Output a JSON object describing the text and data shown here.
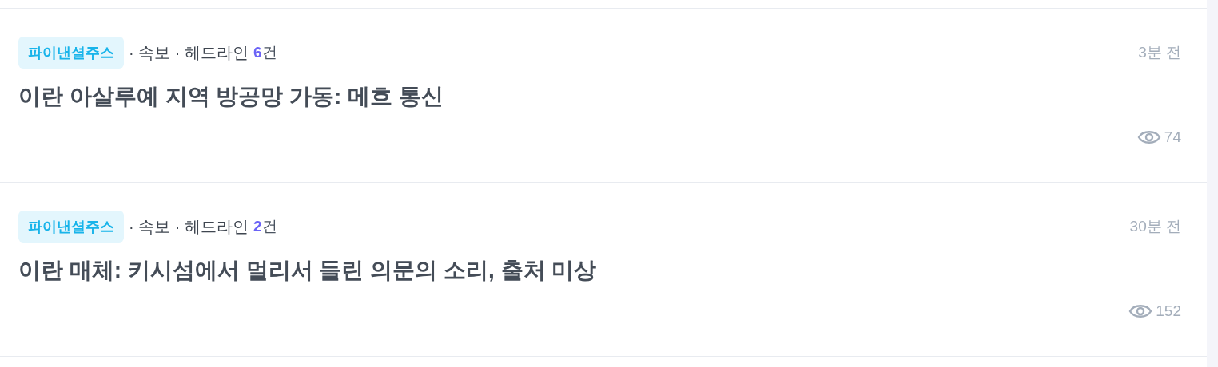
{
  "news_items": [
    {
      "source": "파이낸셜주스",
      "meta": "· 속보 · 헤드라인",
      "count": "6",
      "count_unit": "건",
      "time": "3분 전",
      "title": "이란 아살루예 지역 방공망 가동: 메흐 통신",
      "views": "74"
    },
    {
      "source": "파이낸셜주스",
      "meta": "· 속보 · 헤드라인",
      "count": "2",
      "count_unit": "건",
      "time": "30분 전",
      "title": "이란 매체: 키시섬에서 멀리서 들린 의문의 소리, 출처 미상",
      "views": "152"
    }
  ]
}
